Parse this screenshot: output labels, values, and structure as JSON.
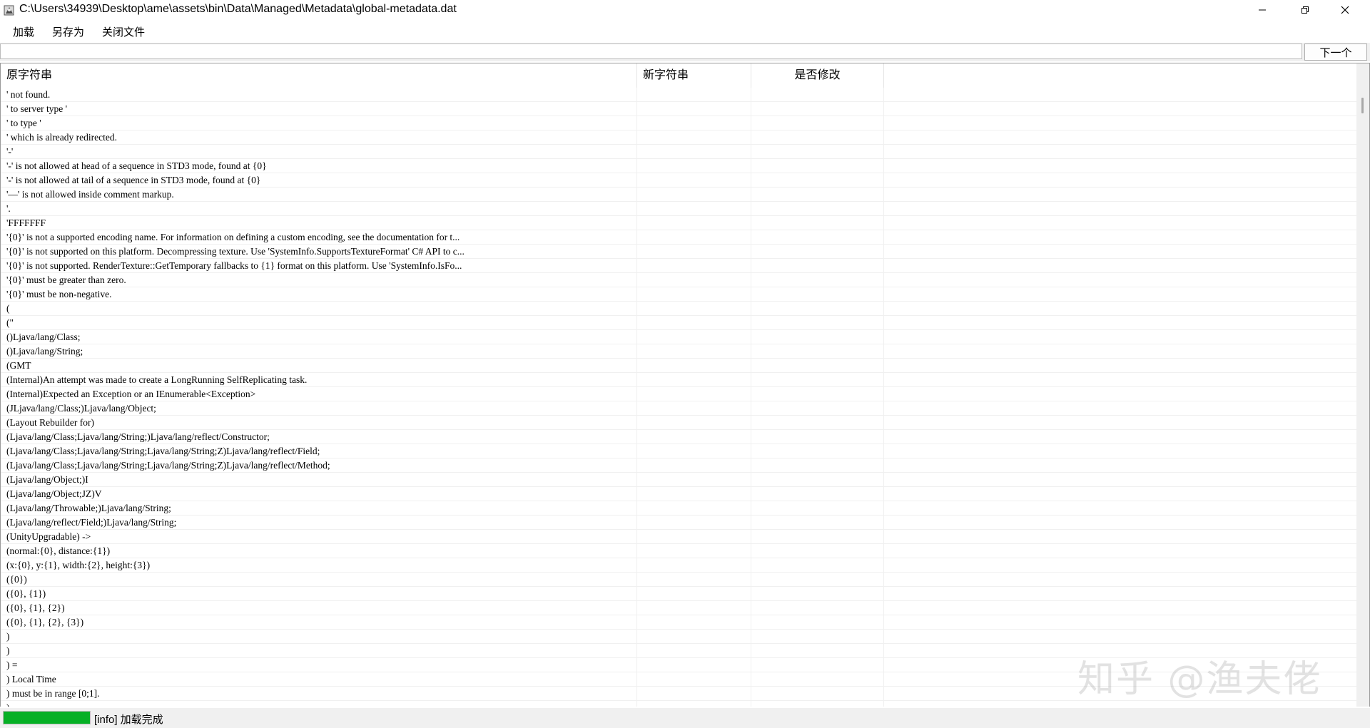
{
  "window": {
    "title": "C:\\Users\\34939\\Desktop\\ame\\assets\\bin\\Data\\Managed\\Metadata\\global-metadata.dat",
    "icon": "app-icon"
  },
  "menu": {
    "load": "加载",
    "save_as": "另存为",
    "close_file": "关闭文件"
  },
  "search": {
    "value": "",
    "next_label": "下一个"
  },
  "table": {
    "columns": [
      "原字符串",
      "新字符串",
      "是否修改"
    ],
    "rows": [
      "' not found.",
      "' to server type '",
      "' to type '",
      "' which is already redirected.",
      "'-'",
      "'-' is not allowed at head of a sequence in STD3 mode, found at {0}",
      "'-' is not allowed at tail of a sequence in STD3 mode, found at {0}",
      "'—' is not allowed inside comment markup.",
      "'.",
      "'FFFFFFF",
      "'{0}' is not a supported encoding name. For information on defining a custom encoding, see the documentation for t...",
      "'{0}' is not supported on this platform. Decompressing texture. Use 'SystemInfo.SupportsTextureFormat' C# API to c...",
      "'{0}' is not supported. RenderTexture::GetTemporary fallbacks to {1} format on this platform. Use 'SystemInfo.IsFo...",
      "'{0}' must be greater than zero.",
      "'{0}' must be non-negative.",
      "(",
      "(\"",
      "()Ljava/lang/Class;",
      "()Ljava/lang/String;",
      "(GMT",
      "(Internal)An attempt was made to create a LongRunning SelfReplicating task.",
      "(Internal)Expected an Exception or an IEnumerable<Exception>",
      "(JLjava/lang/Class;)Ljava/lang/Object;",
      "(Layout Rebuilder for)",
      "(Ljava/lang/Class;Ljava/lang/String;)Ljava/lang/reflect/Constructor;",
      "(Ljava/lang/Class;Ljava/lang/String;Ljava/lang/String;Z)Ljava/lang/reflect/Field;",
      "(Ljava/lang/Class;Ljava/lang/String;Ljava/lang/String;Z)Ljava/lang/reflect/Method;",
      "(Ljava/lang/Object;)I",
      "(Ljava/lang/Object;JZ)V",
      "(Ljava/lang/Throwable;)Ljava/lang/String;",
      "(Ljava/lang/reflect/Field;)Ljava/lang/String;",
      "(UnityUpgradable) ->",
      "(normal:{0}, distance:{1})",
      "(x:{0}, y:{1}, width:{2}, height:{3})",
      "({0})",
      "({0}, {1})",
      "({0}, {1}, {2})",
      "({0}, {1}, {2}, {3})",
      ")",
      ")",
      ") =",
      ") Local Time",
      ") must be in range [0;1].",
      ")"
    ]
  },
  "watermark": "知乎 @渔夫佬",
  "status": {
    "text": "[info] 加载完成",
    "progress": 1.0,
    "progress_color": "#06b025"
  }
}
